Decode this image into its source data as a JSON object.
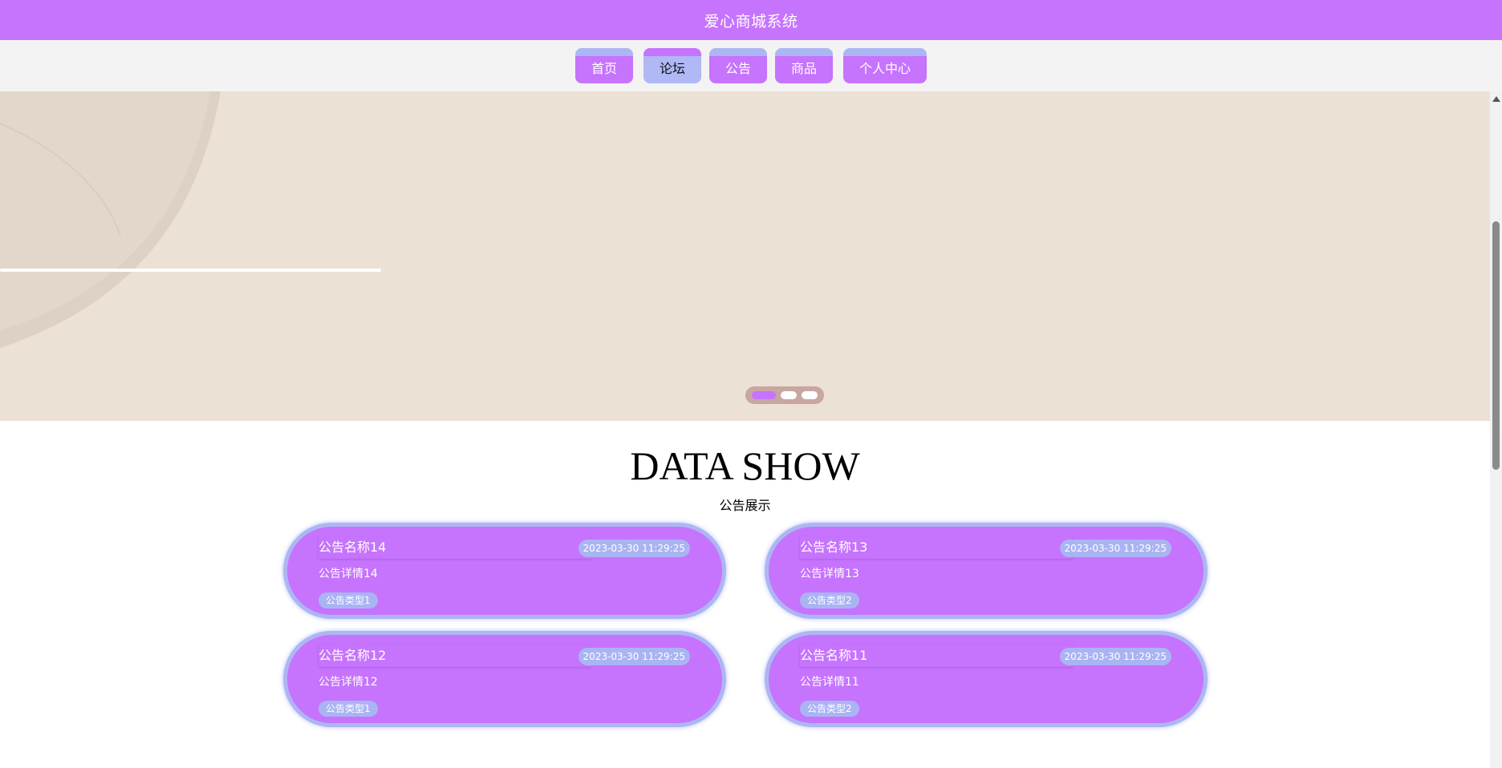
{
  "header": {
    "title": "爱心商城系统"
  },
  "nav": {
    "items": [
      {
        "label": "首页",
        "active": false
      },
      {
        "label": "论坛",
        "active": true
      },
      {
        "label": "公告",
        "active": false
      },
      {
        "label": "商品",
        "active": false
      },
      {
        "label": "个人中心",
        "active": false
      }
    ]
  },
  "banner": {
    "background_color": "#ebe1d4",
    "dots": {
      "count": 3,
      "active_index": 0
    }
  },
  "section": {
    "title": "DATA SHOW",
    "subtitle": "公告展示"
  },
  "notices": [
    {
      "title": "公告名称14",
      "date": "2023-03-30 11:29:25",
      "detail": "公告详情14",
      "type": "公告类型1"
    },
    {
      "title": "公告名称13",
      "date": "2023-03-30 11:29:25",
      "detail": "公告详情13",
      "type": "公告类型2"
    },
    {
      "title": "公告名称12",
      "date": "2023-03-30 11:29:25",
      "detail": "公告详情12",
      "type": "公告类型1"
    },
    {
      "title": "公告名称11",
      "date": "2023-03-30 11:29:25",
      "detail": "公告详情11",
      "type": "公告类型2"
    }
  ],
  "colors": {
    "primary": "#c673fd",
    "secondary": "#adb6f4",
    "nav_background": "#f3f3f3"
  }
}
